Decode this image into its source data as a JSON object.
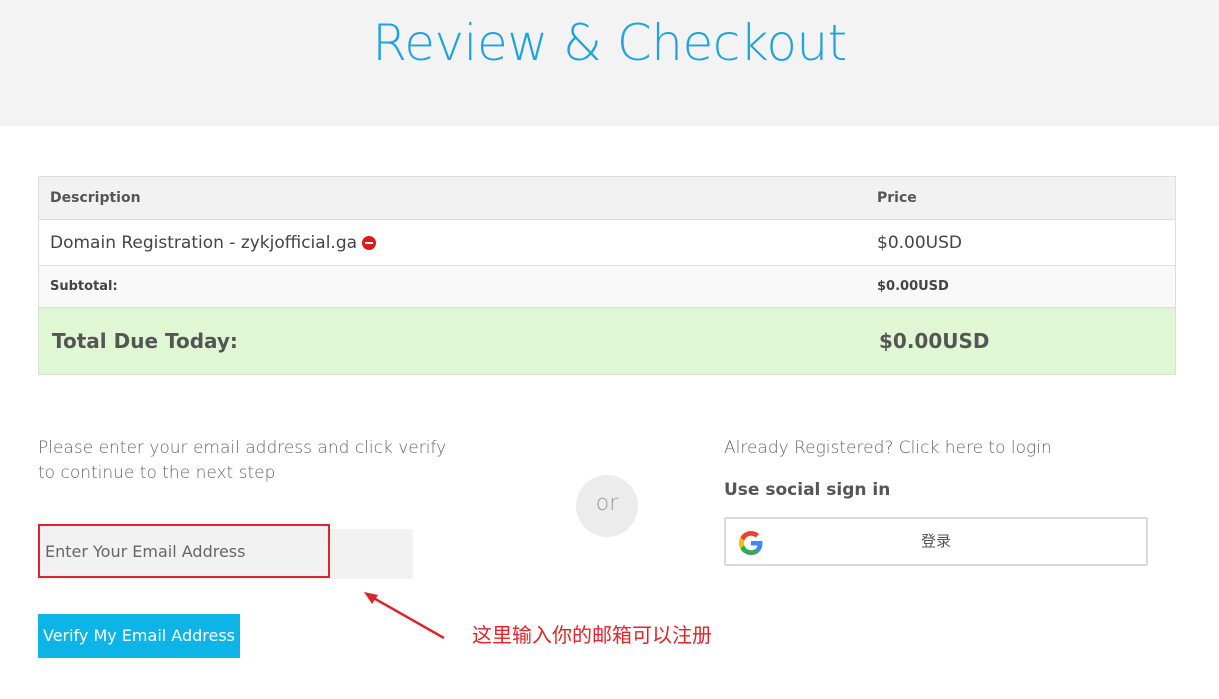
{
  "header": {
    "title": "Review & Checkout"
  },
  "cart": {
    "columns": {
      "description": "Description",
      "price": "Price"
    },
    "item": {
      "description": "Domain Registration - zykjofficial.ga",
      "price": "$0.00USD",
      "remove_icon": "remove-circle-icon"
    },
    "subtotal": {
      "label": "Subtotal:",
      "value": "$0.00USD"
    },
    "total": {
      "label": "Total Due Today:",
      "value": "$0.00USD"
    }
  },
  "verify": {
    "instructions": "Please enter your email address and click verify to continue to the next step",
    "email_placeholder": "Enter Your Email Address",
    "email_value": "",
    "button_label": "Verify My Email Address"
  },
  "divider": {
    "or_label": "or"
  },
  "login": {
    "link_text": "Already Registered? Click here to login",
    "social_heading": "Use social sign in",
    "google_label": "登录",
    "google_icon": "google-icon"
  },
  "annotation": {
    "text": "这里输入你的邮箱可以注册"
  },
  "colors": {
    "accent": "#1fa3dd",
    "button": "#0db4e8",
    "total_bg": "#dff7d3",
    "highlight": "#d9252b",
    "annotation": "#e0242a"
  }
}
